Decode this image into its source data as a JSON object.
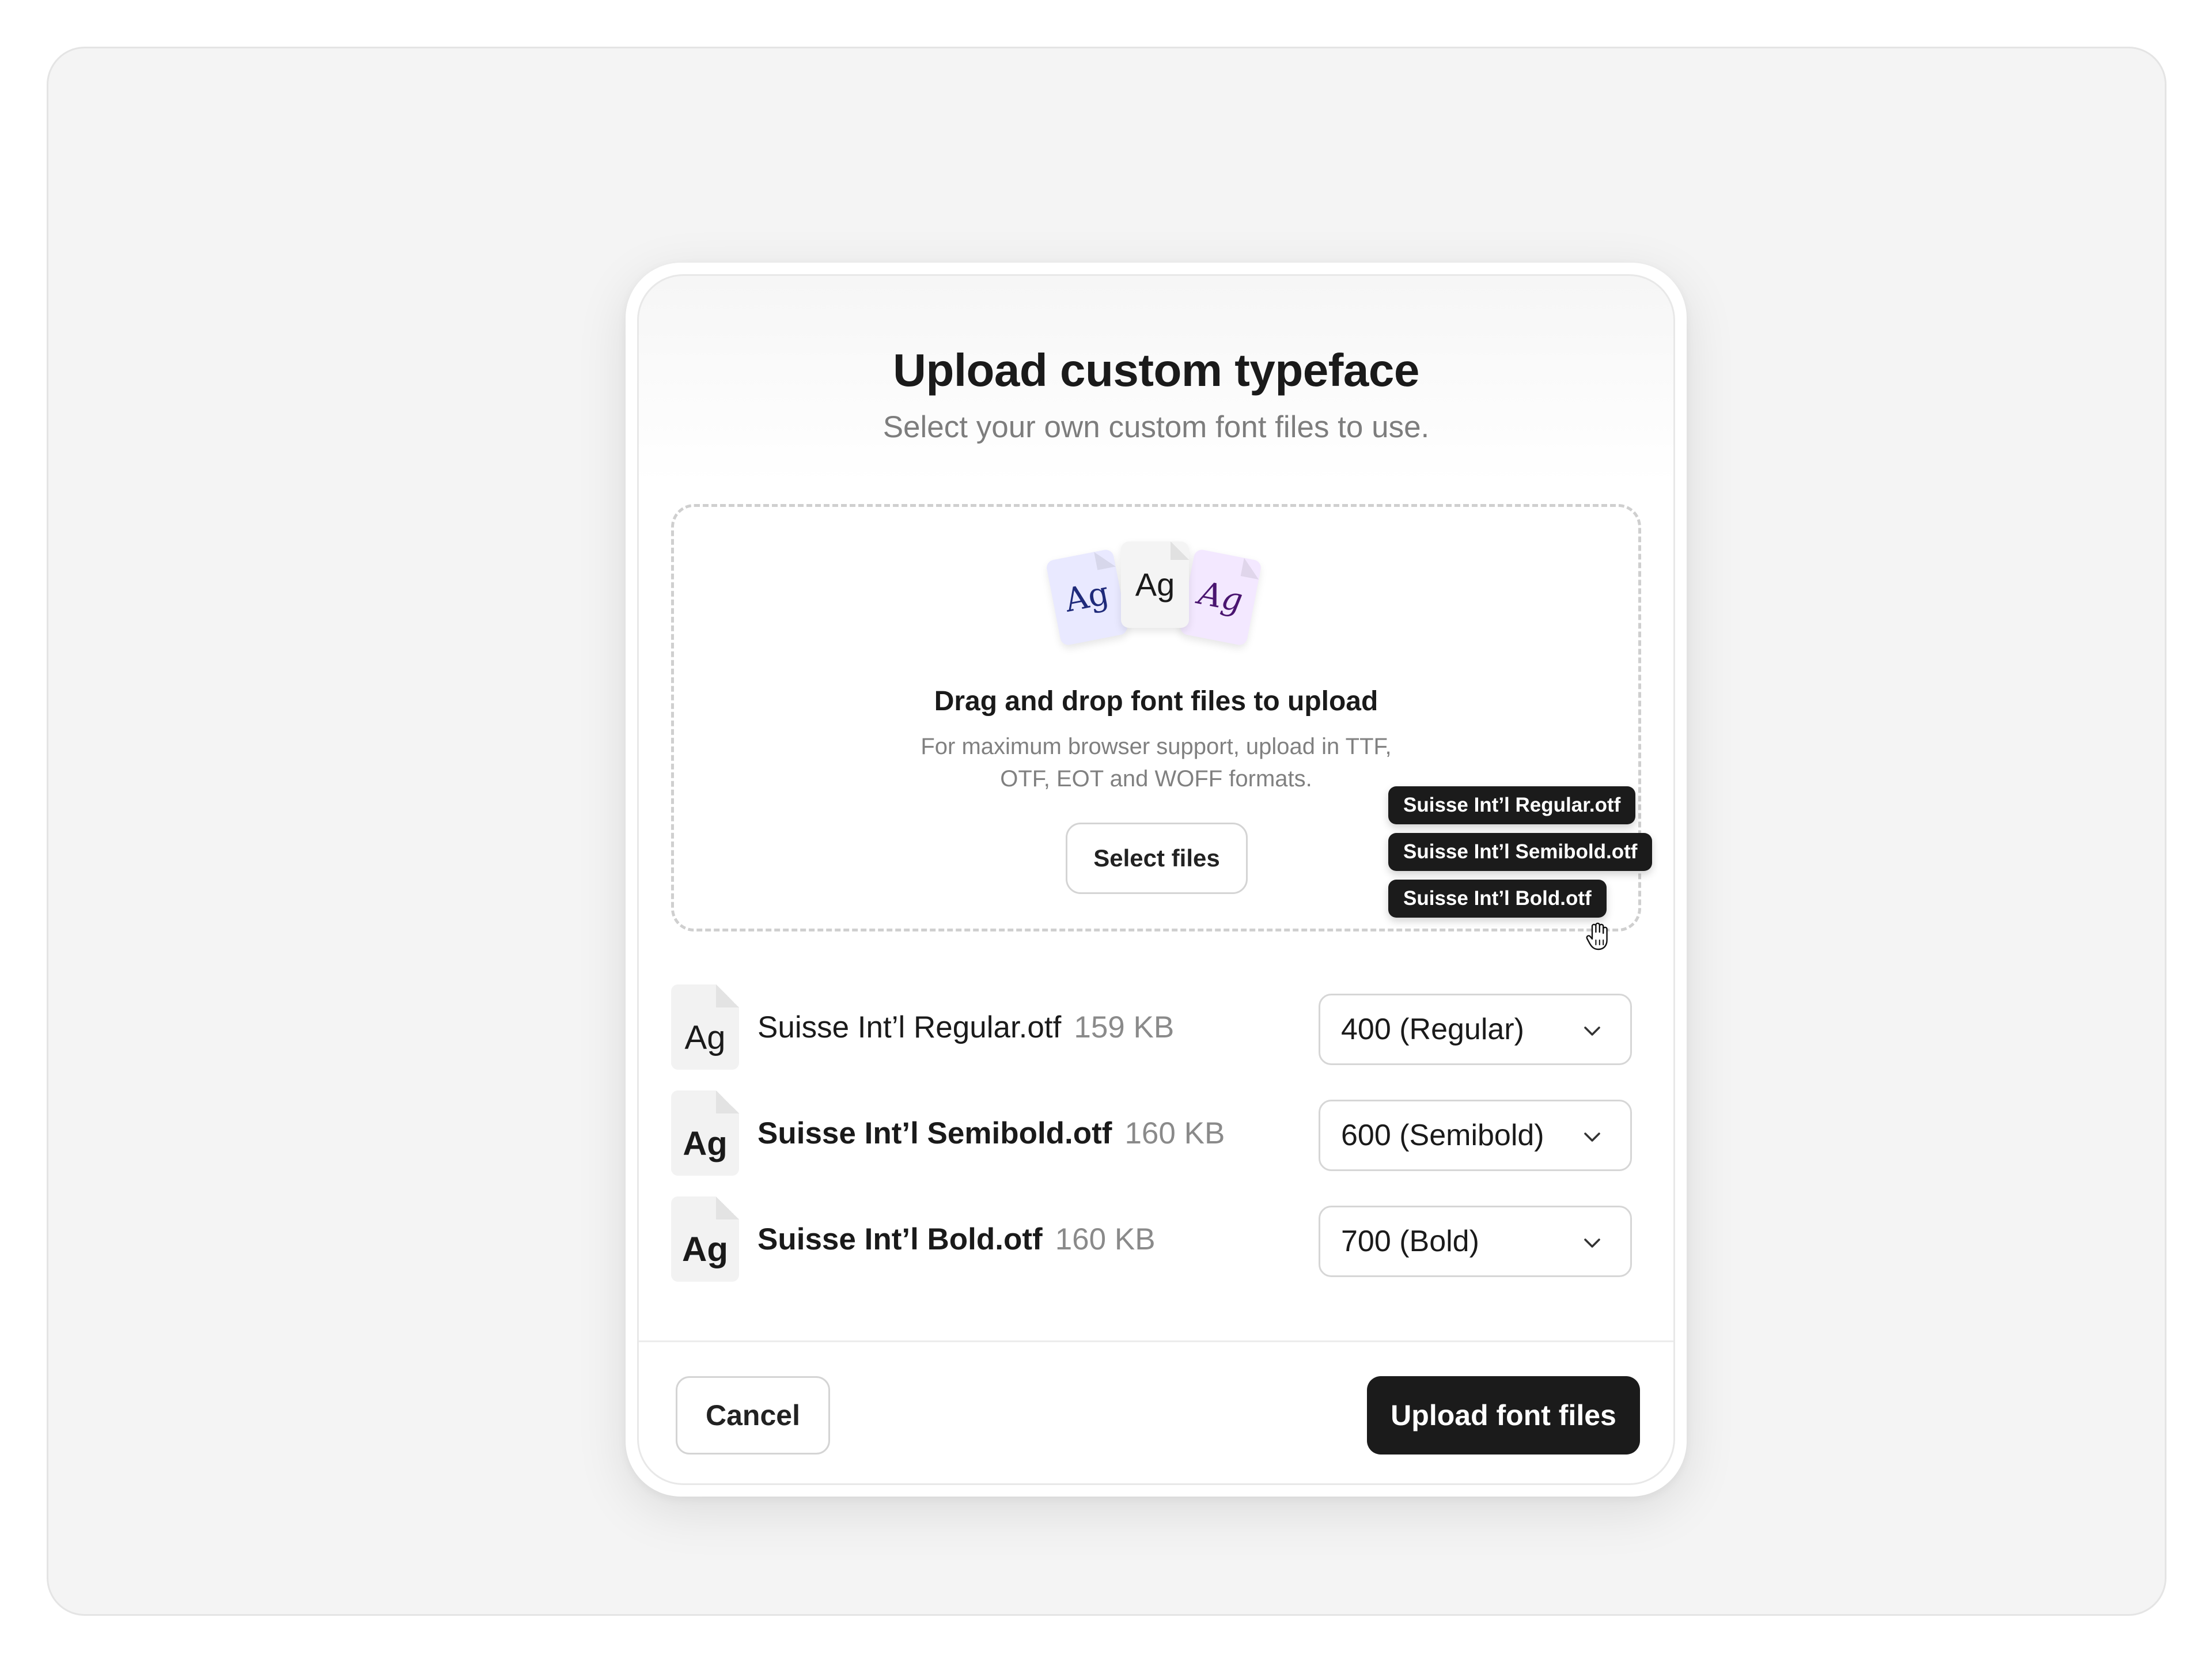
{
  "dialog": {
    "title": "Upload custom typeface",
    "subtitle": "Select your own custom font files to use."
  },
  "dropzone": {
    "preview_glyphs": [
      "Ag",
      "Ag",
      "Ag"
    ],
    "title": "Drag and drop font files to upload",
    "description": "For maximum browser support, upload in TTF, OTF, EOT and WOFF formats.",
    "select_button": "Select files",
    "dragging_files": [
      "Suisse Int’l Regular.otf",
      "Suisse Int’l Semibold.otf",
      "Suisse Int’l Bold.otf"
    ],
    "cursor_icon": "grab-hand-icon"
  },
  "files": [
    {
      "glyph": "Ag",
      "name": "Suisse Int’l Regular.otf",
      "size": "159 KB",
      "weight": "400 (Regular)"
    },
    {
      "glyph": "Ag",
      "name": "Suisse Int’l Semibold.otf",
      "size": "160 KB",
      "weight": "600 (Semibold)"
    },
    {
      "glyph": "Ag",
      "name": "Suisse Int’l Bold.otf",
      "size": "160 KB",
      "weight": "700 (Bold)"
    }
  ],
  "footer": {
    "cancel": "Cancel",
    "upload": "Upload font files"
  },
  "colors": {
    "primary_button": "#1b1b1b",
    "background": "#f4f4f4",
    "muted_text": "#7d7d7d"
  }
}
